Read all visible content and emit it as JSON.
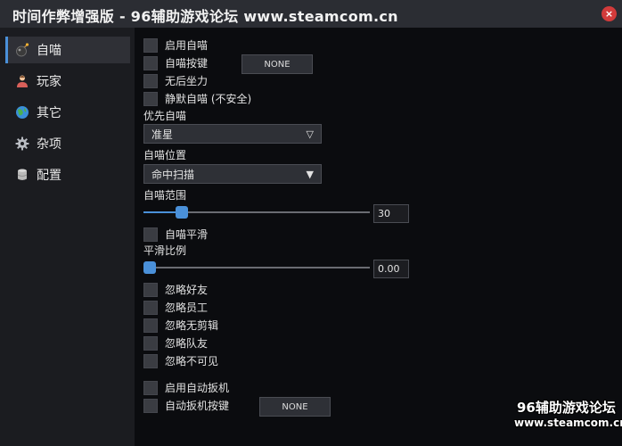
{
  "window": {
    "title": "时间作弊增强版 - 96辅助游戏论坛 www.steamcom.cn",
    "close_glyph": "×"
  },
  "sidebar": {
    "items": [
      {
        "label": "自喵",
        "icon": "bomb-icon",
        "active": true
      },
      {
        "label": "玩家",
        "icon": "person-icon",
        "active": false
      },
      {
        "label": "其它",
        "icon": "globe-icon",
        "active": false
      },
      {
        "label": "杂项",
        "icon": "gear-icon",
        "active": false
      },
      {
        "label": "配置",
        "icon": "database-icon",
        "active": false
      }
    ]
  },
  "aim": {
    "enable_label": "启用自喵",
    "key_label": "自喵按键",
    "key_value": "NONE",
    "norecoil_label": "无后坐力",
    "silent_label": "静默自喵 (不安全)",
    "priority_title": "优先自喵",
    "priority_value": "准星",
    "position_title": "自喵位置",
    "position_value": "命中扫描",
    "range_title": "自喵范围",
    "range_value": "30",
    "range_fraction": 0.17,
    "smooth_label": "自喵平滑",
    "smooth_ratio_title": "平滑比例",
    "smooth_ratio_value": "0.00",
    "smooth_ratio_fraction": 0.0,
    "ignore_friends": "忽略好友",
    "ignore_staff": "忽略员工",
    "ignore_noclip": "忽略无剪辑",
    "ignore_team": "忽略队友",
    "ignore_invisible": "忽略不可见",
    "trigger_enable_label": "启用自动扳机",
    "trigger_key_label": "自动扳机按键",
    "trigger_key_value": "NONE"
  },
  "watermark": {
    "line1": "96辅助游戏论坛",
    "line2": "www.steamcom.cn"
  },
  "colors": {
    "accent": "#4a90d9",
    "close": "#d23b3b",
    "background": "#0b0c0f",
    "sidebar": "#1b1c20"
  }
}
